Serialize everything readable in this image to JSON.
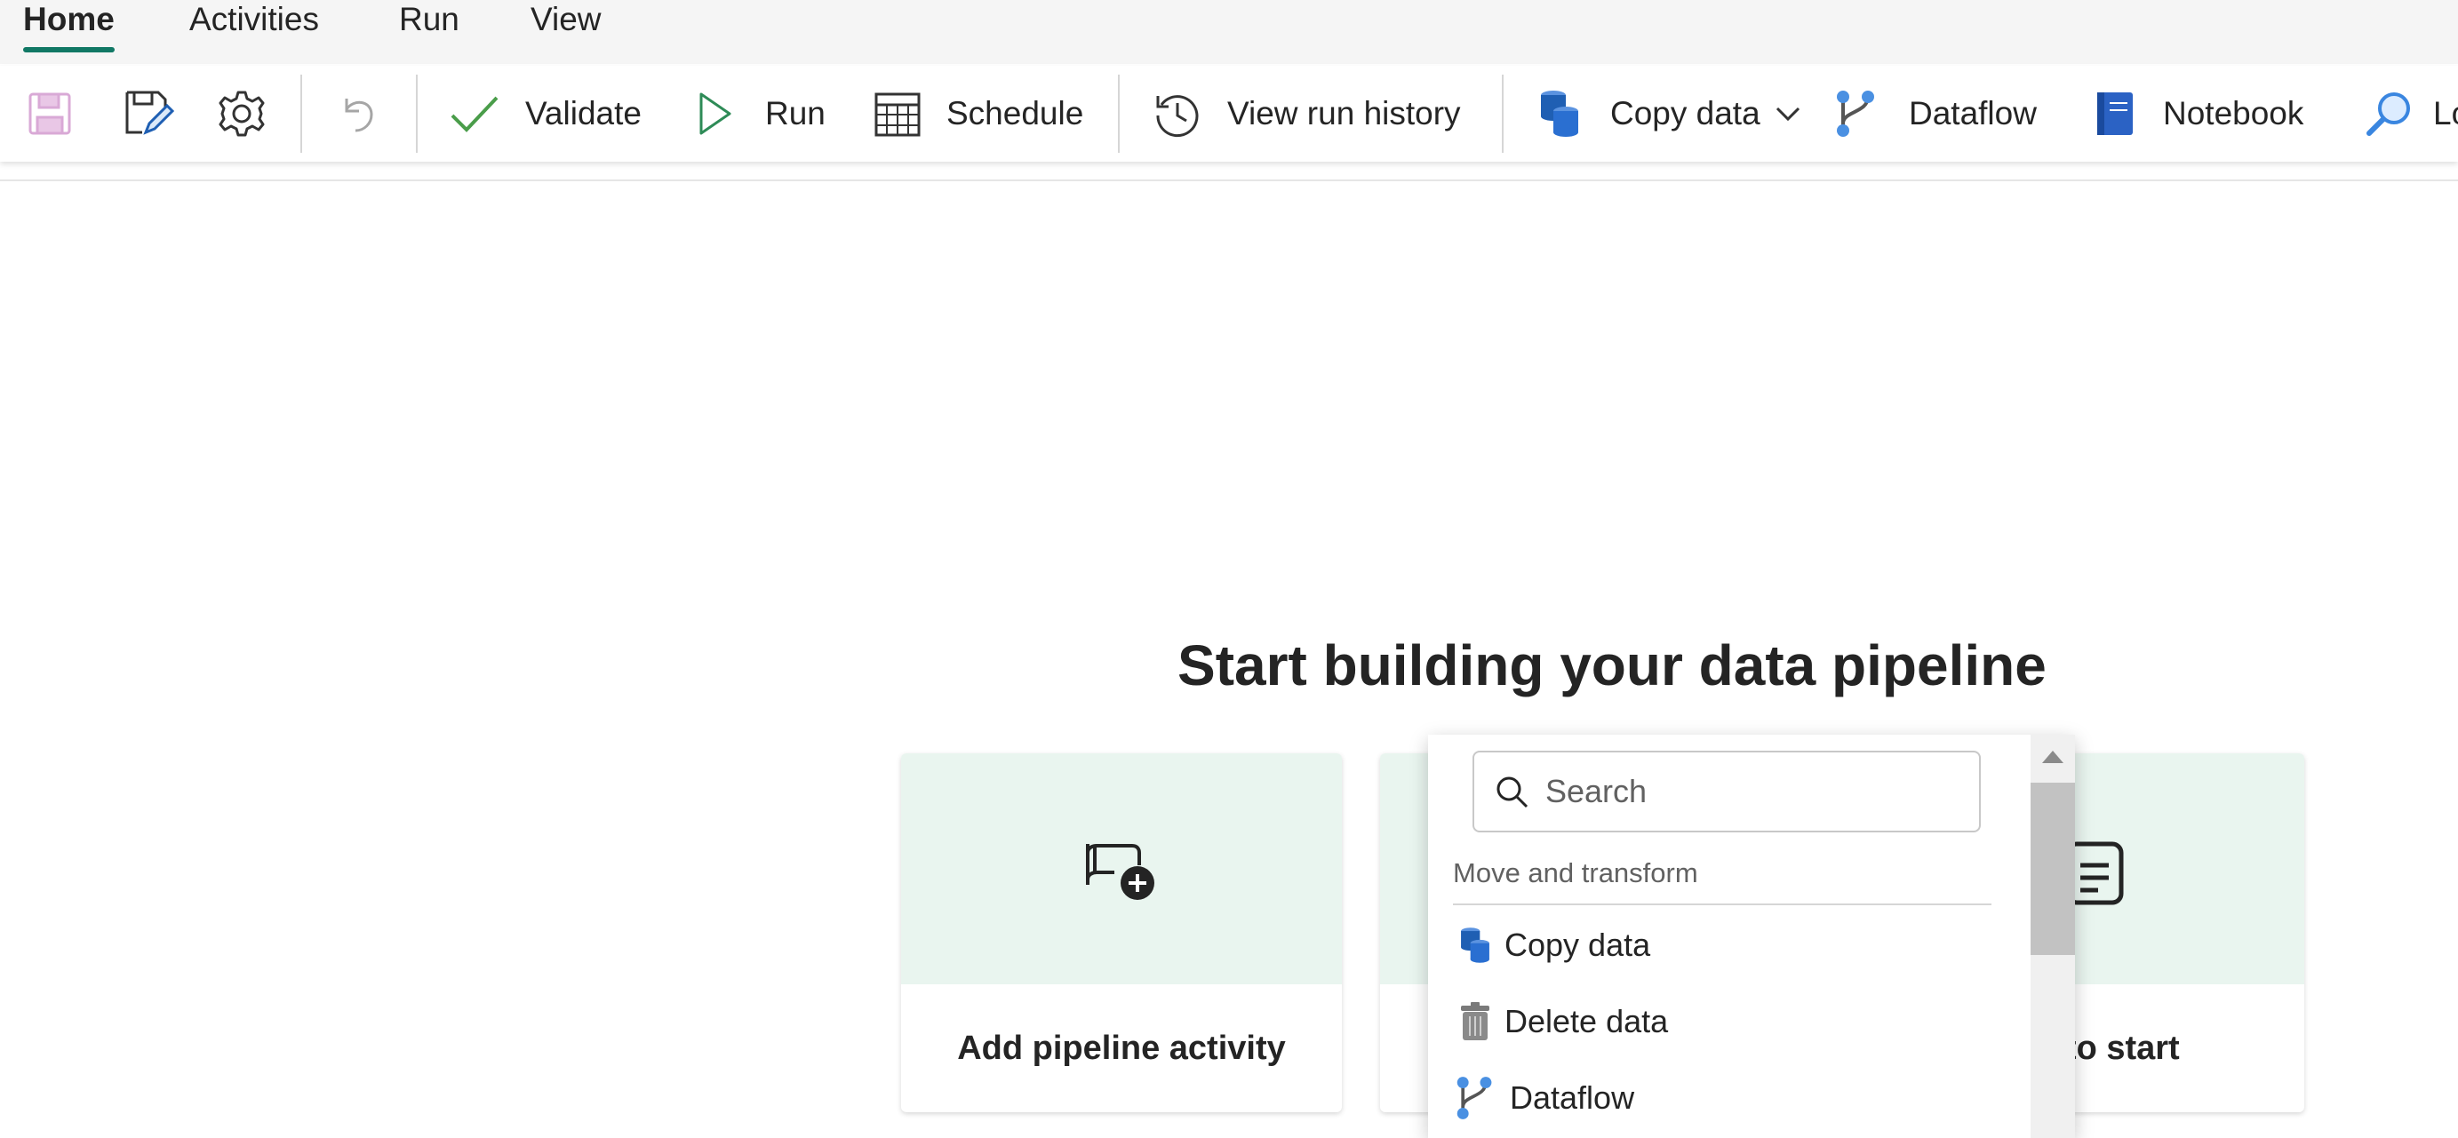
{
  "tabs": [
    {
      "label": "Home",
      "active": true
    },
    {
      "label": "Activities"
    },
    {
      "label": "Run"
    },
    {
      "label": "View"
    }
  ],
  "ribbon": {
    "save_icon": "save-icon",
    "save_as_icon": "save-edit-icon",
    "settings_icon": "gear-icon",
    "undo_icon": "undo-icon",
    "validate_label": "Validate",
    "run_label": "Run",
    "schedule_label": "Schedule",
    "view_run_history_label": "View run history",
    "copy_data_label": "Copy data",
    "dataflow_label": "Dataflow",
    "notebook_label": "Notebook",
    "lookup_label_partial": "Lo"
  },
  "main": {
    "title": "Start building your data pipeline",
    "cards": [
      {
        "label": "Add pipeline activity",
        "icon": "pipeline-add-icon"
      },
      {
        "label": "",
        "icon": ""
      },
      {
        "label": "task to start",
        "icon": "task-icon"
      }
    ]
  },
  "dropdown": {
    "search_placeholder": "Search",
    "section_title": "Move and transform",
    "items": [
      {
        "label": "Copy data",
        "icon": "copy-data-icon"
      },
      {
        "label": "Delete data",
        "icon": "trash-icon"
      },
      {
        "label": "Dataflow",
        "icon": "dataflow-icon"
      }
    ]
  },
  "colors": {
    "accent": "#117865",
    "card_header": "#e9f5ef",
    "validate_check": "#4a9d4a",
    "run_triangle": "#2e8b57",
    "copy_data_blue": "#1f5fb3",
    "notebook_blue": "#2b62c4",
    "save_disabled": "#d9a9d6"
  }
}
